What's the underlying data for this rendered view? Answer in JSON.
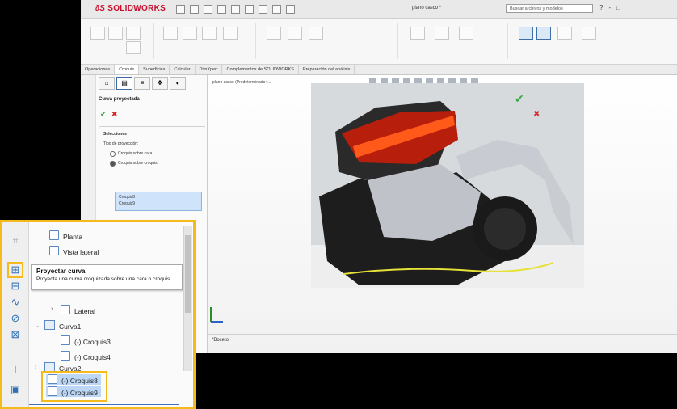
{
  "app": {
    "brand": "SOLIDWORKS",
    "document_title": "plano casco *",
    "search_placeholder": "Buscar archivos y modelos",
    "window_controls": [
      "?",
      "-",
      "□"
    ]
  },
  "command_tabs": [
    "Operaciones",
    "Croquis",
    "Superficies",
    "Calcular",
    "DimXpert",
    "Complementos de SOLIDWORKS",
    "Preparación del análisis"
  ],
  "active_tab": "Croquis",
  "property_manager": {
    "title": "Curva proyectada",
    "section": "Selecciones",
    "projection_type_label": "Tipo de proyección:",
    "options": [
      "Croquis sobre cara",
      "Croquis sobre croquis"
    ],
    "selected_option": 1,
    "selections": [
      "Croquis8",
      "Croquis9"
    ]
  },
  "graphics": {
    "tree_label": "plano casco (Predeterminado<...",
    "view_name": "*Boceto"
  },
  "zoom_panel": {
    "tooltip": {
      "title": "Proyectar curva",
      "body": "Proyecta una curva croquizada sobre una cara o croquis."
    },
    "tree": [
      {
        "label": "Planta"
      },
      {
        "label": "Vista lateral"
      },
      {
        "label": "Lateral"
      },
      {
        "label": "Curva1"
      },
      {
        "label": "(-) Croquis3"
      },
      {
        "label": "(-) Croquis4"
      },
      {
        "label": "Curva2"
      },
      {
        "label": "(-) Croquis8"
      },
      {
        "label": "(-) Croquis9"
      }
    ]
  },
  "colors": {
    "highlight": "#f5bb1c",
    "brand_red": "#c8102e",
    "selection_blue": "#bcd7f5",
    "accept_green": "#3aa845"
  }
}
